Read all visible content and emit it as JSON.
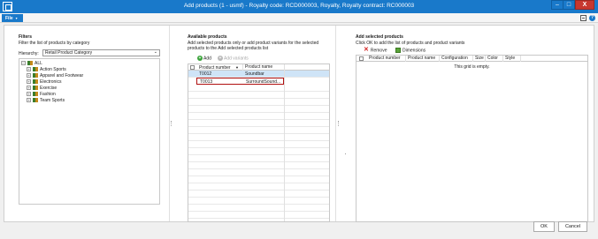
{
  "window": {
    "title": "Add products (1 - usmf) - Royalty code: RCD000003, Royalty, Royalty contract: RC000003",
    "minimize": "–",
    "maximize": "□",
    "close": "X"
  },
  "menu": {
    "file_label": "File",
    "file_caret": "▾",
    "help": "?"
  },
  "filters": {
    "title": "Filters",
    "description": "Filter the list of products by category",
    "hierarchy_label": "Hierarchy:",
    "hierarchy_value": "Retail Product Category",
    "tree": [
      {
        "label": "ALL",
        "expander": "−"
      },
      {
        "label": "Action Sports",
        "expander": "+"
      },
      {
        "label": "Apparel and Footwear",
        "expander": "+"
      },
      {
        "label": "Electronics",
        "expander": "+"
      },
      {
        "label": "Exercise",
        "expander": "+"
      },
      {
        "label": "Fashion",
        "expander": "+"
      },
      {
        "label": "Team Sports",
        "expander": "+"
      }
    ]
  },
  "available": {
    "title": "Available products",
    "description": "Add selected products only or add product variants for the selected products to the Add selected products list",
    "add_label": "Add",
    "add_variants_label": "Add variants",
    "columns": [
      "Product number",
      "Product name"
    ],
    "sort_indicator": "▼",
    "rows": [
      {
        "number": "T0012",
        "name": "Soundbar"
      },
      {
        "number": "T0013",
        "name": "SurroundSound..."
      }
    ]
  },
  "selected": {
    "title": "Add selected products",
    "description": "Click OK to add the list of products and product variants",
    "remove_label": "Remove",
    "dimensions_label": "Dimensions",
    "columns": [
      "Product number",
      "Product name",
      "Configuration",
      "Size",
      "Color",
      "Style"
    ],
    "empty_message": "This grid is empty."
  },
  "footer": {
    "ok_label": "OK",
    "cancel_label": "Cancel"
  },
  "colors": {
    "accent": "#1979ca",
    "close": "#c7372f",
    "selection": "#cfe4f7",
    "focus_border": "#b01010"
  },
  "icons": [
    "app-icon",
    "view-icon",
    "help-icon",
    "add-icon",
    "add-variants-icon",
    "remove-icon",
    "dimensions-icon",
    "category-icon"
  ]
}
